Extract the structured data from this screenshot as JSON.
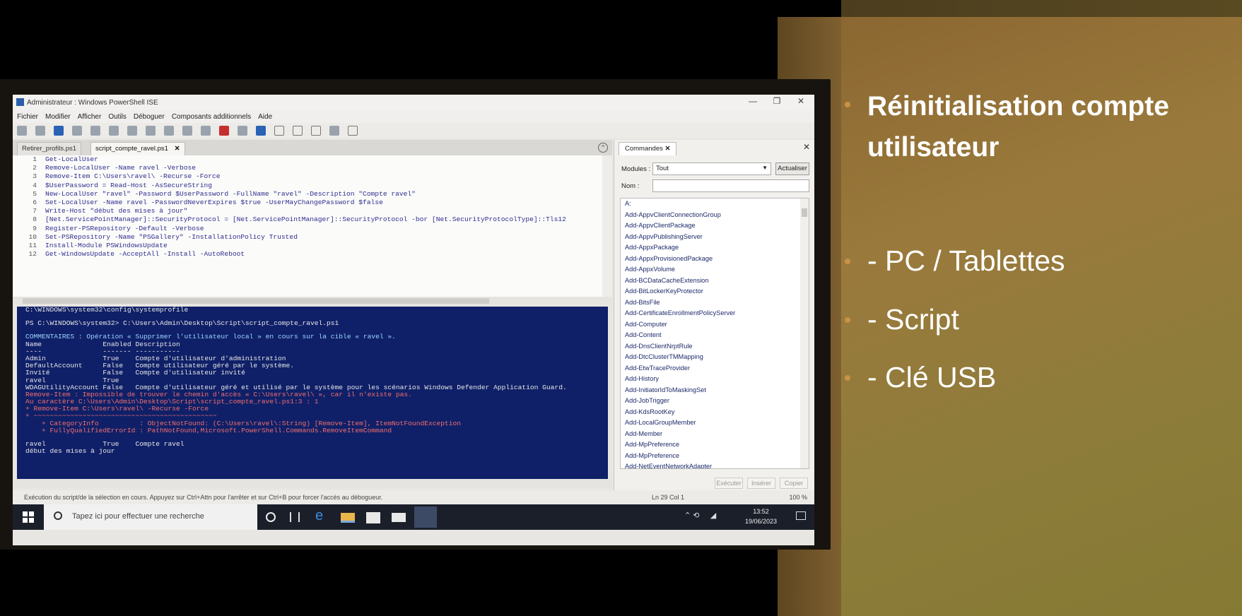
{
  "slide": {
    "bullets": [
      "Réinitialisation compte utilisateur",
      "- PC / Tablettes",
      "- Script",
      "- Clé USB"
    ],
    "accent": "#c89248"
  },
  "window": {
    "title": "Administrateur : Windows PowerShell ISE",
    "controls": [
      "—",
      "❐",
      "✕"
    ]
  },
  "menu": [
    "Fichier",
    "Modifier",
    "Afficher",
    "Outils",
    "Déboguer",
    "Composants additionnels",
    "Aide"
  ],
  "tabs": [
    {
      "label": "Retirer_profils.ps1",
      "active": false
    },
    {
      "label": "script_compte_ravel.ps1",
      "active": true
    }
  ],
  "editor": {
    "lines": [
      "Get-LocalUser",
      "Remove-LocalUser -Name ravel -Verbose",
      "Remove-Item C:\\Users\\ravel\\ -Recurse -Force",
      "$UserPassword = Read-Host -AsSecureString",
      "New-LocalUser \"ravel\" -Password $UserPassword -FullName \"ravel\" -Description \"Compte ravel\"",
      "Set-LocalUser -Name ravel -PasswordNeverExpires $true -UserMayChangePassword $false",
      "Write-Host \"début des mises à jour\"",
      "[Net.ServicePointManager]::SecurityProtocol = [Net.ServicePointManager]::SecurityProtocol -bor [Net.SecurityProtocolType]::Tls12",
      "Register-PSRepository -Default -Verbose",
      "Set-PSRepository -Name \"PSGallery\" -InstallationPolicy Trusted",
      "Install-Module PSWindowsUpdate",
      "Get-WindowsUpdate -AcceptAll -Install -AutoReboot"
    ]
  },
  "console": {
    "lines": [
      {
        "t": "C:\\WINDOWS\\system32\\config\\systemprofile",
        "k": ""
      },
      {
        "t": "",
        "k": "blank"
      },
      {
        "t": "PS C:\\WINDOWS\\system32> C:\\Users\\Admin\\Desktop\\Script\\script_compte_ravel.ps1",
        "k": ""
      },
      {
        "t": "",
        "k": "blank"
      },
      {
        "t": "COMMENTAIRES : Opération « Supprimer l'utilisateur local » en cours sur la cible « ravel ».",
        "k": "cyan"
      },
      {
        "t": "Name               Enabled Description",
        "k": ""
      },
      {
        "t": "----               ------- -----------",
        "k": ""
      },
      {
        "t": "Admin              True    Compte d'utilisateur d'administration",
        "k": ""
      },
      {
        "t": "DefaultAccount     False   Compte utilisateur géré par le système.",
        "k": ""
      },
      {
        "t": "Invité             False   Compte d'utilisateur invité",
        "k": ""
      },
      {
        "t": "ravel              True",
        "k": ""
      },
      {
        "t": "WDAGUtilityAccount False   Compte d'utilisateur géré et utilisé par le système pour les scénarios Windows Defender Application Guard.",
        "k": ""
      },
      {
        "t": "Remove-Item : Impossible de trouver le chemin d'accès « C:\\Users\\ravel\\ », car il n'existe pas.",
        "k": "err"
      },
      {
        "t": "Au caractère C:\\Users\\Admin\\Desktop\\Script\\script_compte_ravel.ps1:3 : 1",
        "k": "err"
      },
      {
        "t": "+ Remove-Item C:\\Users\\ravel\\ -Recurse -Force",
        "k": "err"
      },
      {
        "t": "+ ~~~~~~~~~~~~~~~~~~~~~~~~~~~~~~~~~~~~~~~~~~~~~",
        "k": "err"
      },
      {
        "t": "    + CategoryInfo          : ObjectNotFound: (C:\\Users\\ravel\\:String) [Remove-Item], ItemNotFoundException",
        "k": "err"
      },
      {
        "t": "    + FullyQualifiedErrorId : PathNotFound,Microsoft.PowerShell.Commands.RemoveItemCommand",
        "k": "err"
      },
      {
        "t": "",
        "k": "blank"
      },
      {
        "t": "ravel              True    Compte ravel",
        "k": ""
      },
      {
        "t": "début des mises à jour",
        "k": ""
      }
    ]
  },
  "commands": {
    "tab": "Commandes",
    "modules_label": "Modules :",
    "modules_value": "Tout",
    "refresh": "Actualiser",
    "name_label": "Nom :",
    "items": [
      "A:",
      "Add-AppvClientConnectionGroup",
      "Add-AppvClientPackage",
      "Add-AppvPublishingServer",
      "Add-AppxPackage",
      "Add-AppxProvisionedPackage",
      "Add-AppxVolume",
      "Add-BCDataCacheExtension",
      "Add-BitLockerKeyProtector",
      "Add-BitsFile",
      "Add-CertificateEnrollmentPolicyServer",
      "Add-Computer",
      "Add-Content",
      "Add-DnsClientNrptRule",
      "Add-DtcClusterTMMapping",
      "Add-EtwTraceProvider",
      "Add-History",
      "Add-InitiatorIdToMaskingSet",
      "Add-JobTrigger",
      "Add-KdsRootKey",
      "Add-LocalGroupMember",
      "Add-Member",
      "Add-MpPreference",
      "Add-MpPreference",
      "Add-NetEventNetworkAdapter"
    ],
    "buttons": [
      "Exécuter",
      "Insérer",
      "Copier"
    ]
  },
  "status": {
    "message": "Exécution du script/de la sélection en cours. Appuyez sur Ctrl+Attn pour l'arrêter et sur Ctrl+B pour forcer l'accès au débogueur.",
    "position": "Ln 29  Col 1",
    "zoom": "100 %"
  },
  "taskbar": {
    "search_placeholder": "Tapez ici pour effectuer une recherche",
    "time": "13:52",
    "date": "19/06/2023"
  }
}
